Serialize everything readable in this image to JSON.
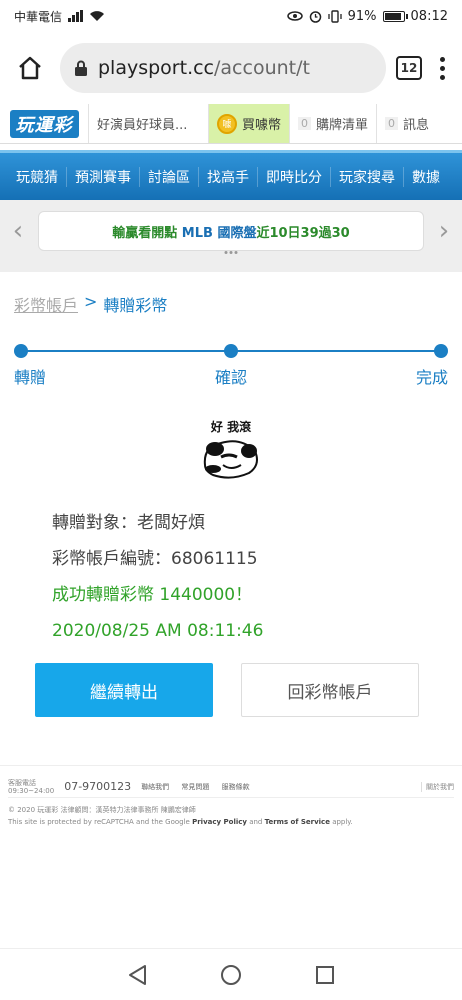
{
  "status_bar": {
    "carrier": "中華電信",
    "battery": "91%",
    "time": "08:12"
  },
  "browser": {
    "url_host": "playsport.cc",
    "url_path": "/account/t",
    "tab_count": "12"
  },
  "site_header": {
    "logo": "玩運彩",
    "username": "好演員好球員...",
    "buy_coin": "買噱幣",
    "coin_icon_text": "噱",
    "cart_count": "0",
    "cart_label": "購牌清單",
    "msg_count": "0",
    "msg_label": "訊息"
  },
  "nav": {
    "items": [
      "玩競猜",
      "預測賽事",
      "討論區",
      "找高手",
      "即時比分",
      "玩家搜尋",
      "數據"
    ]
  },
  "marquee": {
    "prefix": "輸贏看開點",
    "league": "MLB 國際盤",
    "text": "近10日39過30"
  },
  "breadcrumb": {
    "parent": "彩幣帳戶",
    "sep": ">",
    "current": "轉贈彩幣"
  },
  "steps": {
    "step1": "轉贈",
    "step2": "確認",
    "step3": "完成"
  },
  "meme": {
    "caption": "好 我滾"
  },
  "info": {
    "target": "轉贈對象：老闆好煩",
    "account": "彩幣帳戶編號：68061115",
    "success": "成功轉贈彩幣 1440000！",
    "datetime": "2020/08/25 AM 08:11:46"
  },
  "buttons": {
    "continue": "繼續轉出",
    "back": "回彩幣帳戶"
  },
  "footer": {
    "phone_label_1": "客服電話",
    "phone_label_2": "09:30~24:00",
    "phone": "07-9700123",
    "links": [
      "聯絡我們",
      "常見問題",
      "服務條款"
    ],
    "about": "關於我們",
    "copyright": "© 2020 玩運彩 法律顧問：漢英特力法律事務所 陳鵬宏律師",
    "recaptcha_pre": "This site is protected by reCAPTCHA and the Google",
    "privacy": "Privacy Policy",
    "and": "and",
    "terms": "Terms of Service",
    "apply": "apply."
  }
}
